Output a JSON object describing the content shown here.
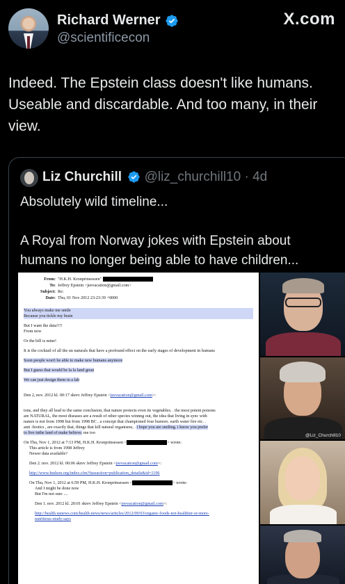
{
  "author": {
    "name": "Richard Werner",
    "handle": "@scientificecon",
    "verified": true
  },
  "brand": "X.com",
  "tweet_text": "Indeed. The Epstein class doesn't like humans. Useable and discardable. And too many, in their view.",
  "quoted": {
    "name": "Liz Churchill",
    "handle": "@liz_churchill10",
    "age": "· 4d",
    "verified": true,
    "text_1": "Absolutely wild timeline...",
    "text_2": "A Royal from Norway jokes with Epstein about humans no longer being able to have children..."
  },
  "document": {
    "from_label": "From:",
    "from_value": "\"H.K.H. Kronprinsessen\"",
    "to_label": "To:",
    "to_value": "Jeffrey Epstein <jeevacation@gmail.com>",
    "subject_label": "Subject:",
    "subject_value": "Re:",
    "date_label": "Date:",
    "date_value": "Thu, 01 Nov 2012 23:23:39 +0000",
    "hl_1": "You always make me smile",
    "hl_2": "Because you tickle my brain",
    "l_data": "But I want the data!!!!",
    "l_from_now": "From now",
    "l_bill": "Or the bill is mine!",
    "l_cocktail": "It is the cocktail of all the un naturals that have a profound effect on the early stages of development in humans",
    "hl_3": "Soon people won't be able to make new humans anymore",
    "hl_4": "But I guess that would be la la land great",
    "hl_5": "We can just design them in a lab",
    "den2_a": "Den 2, nov. 2012 kl. 00:17 skrev Jeffrey Epstein <",
    "den2_a_link": "jeevacation@gmail.com",
    "den2_a_end": ">:",
    "tons_1": "tons, and they all lead to the same conclusion, that nature protects even its vegetables.  . the most potent poisons",
    "tons_2": "are NATURAL,   the most diseases are a result of other species winnng out, the idea that living in sync with",
    "tons_3": "nature is not from 1998 but from 1998 BC  .  a concept that championed four humors. earth water fire etc.   .",
    "tons_4": "anti -biotics , are exactly that,  things that kill natural organisms,   .",
    "tons_4_hl": "i hope you are smiling.  i know you prefer",
    "tons_5_hl": "to live inthe land of make believe.",
    "tons_5": "me too",
    "thu_1_a": "On Thu, Nov 1, 2012 at 7:13 PM, H.K.H. Kronprinsessen <",
    "thu_1_b": "> wrote:",
    "art_1": "This article is from 1998 Jeffrey",
    "art_2": "Newer data available?",
    "den2_b": "Den 2. nov. 2012 kl. 00:06 skrev Jeffrey Epstein <",
    "den2_b_link": "jeevacation@gmail.com",
    "den2_b_end": ">:",
    "hudson": "http://www.hudson.org/index.cfm?fuseaction=publication_details&id=1196",
    "thu_2_a": "On Thu, Nov 1, 2012 at 6:59 PM, H.K.H. Kronprinsessen <",
    "thu_2_b": "> wrote:",
    "and_1": "And I might be done now",
    "and_2": "But I'm not sure ....",
    "den1_a": "Den 1. nov. 2012 kl. 20:01 skrev Jeffrey Epstein <",
    "den1_link": "jeevacation@gmail.com",
    "den1_end": ">:",
    "health_1": "http://health.usnews.com/health-news/news/articles/2012/09/03/organic-foods-not-healthier-or-more-",
    "health_2": "nutritious-study-says"
  },
  "photo_watermark": "@Liz_Churchill10"
}
